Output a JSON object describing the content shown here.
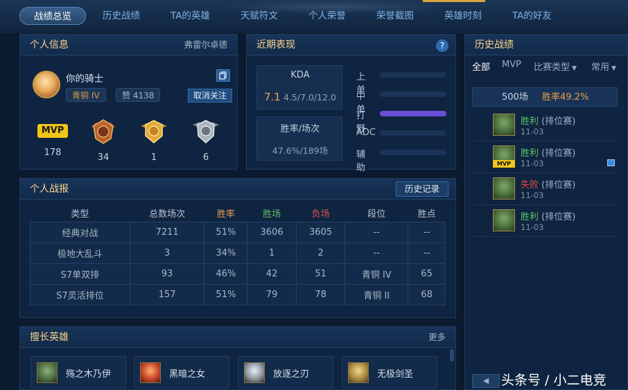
{
  "nav": {
    "tabs": [
      {
        "label": "战绩总览",
        "active": true
      },
      {
        "label": "历史战绩"
      },
      {
        "label": "TA的英雄"
      },
      {
        "label": "天赋符文"
      },
      {
        "label": "个人荣誉"
      },
      {
        "label": "荣誉截图"
      },
      {
        "label": "英雄时刻"
      },
      {
        "label": "TA的好友"
      }
    ]
  },
  "personal": {
    "title": "个人信息",
    "server": "弗雷尔卓德",
    "name": "你的骑士",
    "rank": "青铜 IV",
    "likes": "赞 4138",
    "unfollow": "取消关注",
    "stats": [
      {
        "icon": "mvp-icon",
        "value": "178"
      },
      {
        "icon": "rank-badge-icon",
        "value": "34"
      },
      {
        "icon": "gold-medal-icon",
        "value": "1"
      },
      {
        "icon": "silver-medal-icon",
        "value": "6"
      }
    ],
    "mvp_label": "MVP"
  },
  "recent": {
    "title": "近期表现",
    "help": "?",
    "kda_label": "KDA",
    "kda_value": "7.1",
    "kda_detail": "4.5/7.0/12.0",
    "winrate_label": "胜率/场次",
    "winrate_value": "47.6%/189场",
    "lanes": [
      {
        "label": "上单",
        "fraction": 0
      },
      {
        "label": "中单",
        "fraction": 0
      },
      {
        "label": "打野",
        "fraction": 1
      },
      {
        "label": "ADC",
        "fraction": 0
      },
      {
        "label": "辅助",
        "fraction": 0
      }
    ],
    "lane_fill_color": "#6a4fd4"
  },
  "report": {
    "title": "个人战报",
    "history_btn": "历史记录",
    "headers": [
      "类型",
      "总数场次",
      "胜率",
      "胜场",
      "负场",
      "段位",
      "胜点"
    ],
    "rows": [
      [
        "经典对战",
        "7211",
        "51%",
        "3606",
        "3605",
        "--",
        "--"
      ],
      [
        "极地大乱斗",
        "3",
        "34%",
        "1",
        "2",
        "--",
        "--"
      ],
      [
        "S7单双排",
        "93",
        "46%",
        "42",
        "51",
        "青铜 IV",
        "65"
      ],
      [
        "S7灵活排位",
        "157",
        "51%",
        "79",
        "78",
        "青铜 II",
        "68"
      ]
    ]
  },
  "heroes": {
    "title": "擅长英雄",
    "more": "更多",
    "list": [
      {
        "name": "殇之木乃伊"
      },
      {
        "name": "黑暗之女"
      },
      {
        "name": "放逐之刃"
      },
      {
        "name": "无极剑圣"
      }
    ]
  },
  "history": {
    "title": "历史战绩",
    "filters": [
      "全部",
      "MVP",
      "比赛类型",
      "常用"
    ],
    "total": "500场",
    "winrate": "胜率49.2%",
    "matches": [
      {
        "result": "胜利",
        "type": "(排位赛)",
        "date": "11-03",
        "win": true,
        "mvp": false
      },
      {
        "result": "胜利",
        "type": "(排位赛)",
        "date": "11-03",
        "win": true,
        "mvp": true
      },
      {
        "result": "失败",
        "type": "(排位赛)",
        "date": "11-03",
        "win": false,
        "mvp": false
      },
      {
        "result": "胜利",
        "type": "(排位赛)",
        "date": "11-03",
        "win": true,
        "mvp": false
      }
    ],
    "watermark": "头条号 / 小二电竞"
  }
}
